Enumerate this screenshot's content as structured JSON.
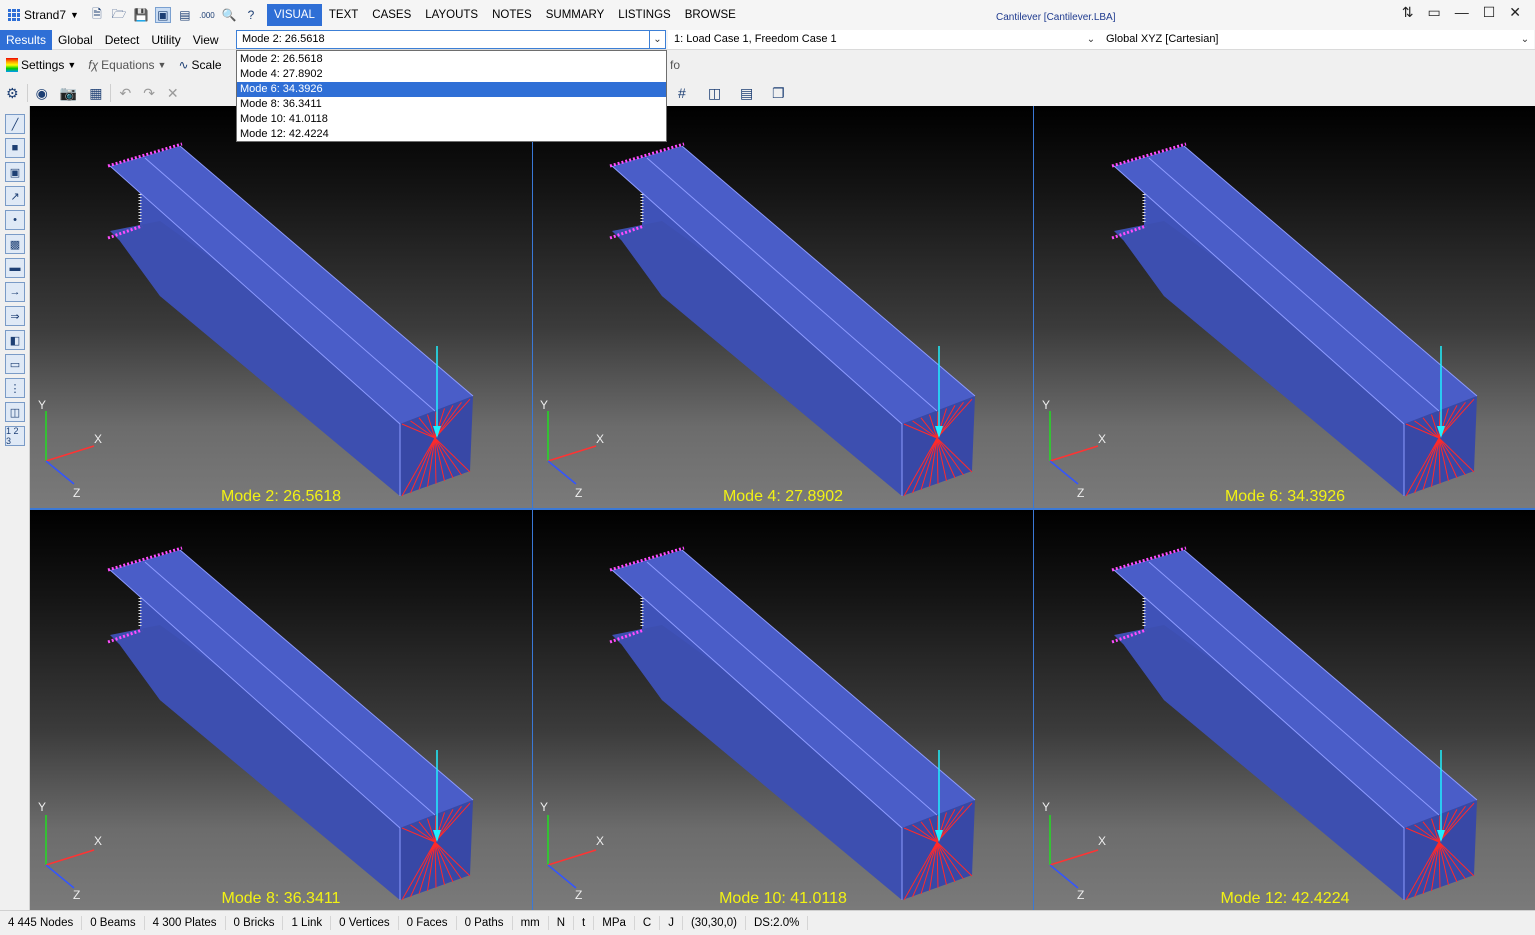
{
  "app": {
    "name": "Strand7",
    "window_title": "Cantilever [Cantilever.LBA]"
  },
  "ribbon_tabs": [
    "VISUAL",
    "TEXT",
    "CASES",
    "LAYOUTS",
    "NOTES",
    "SUMMARY",
    "LISTINGS",
    "BROWSE"
  ],
  "subtabs": [
    "Results",
    "Global",
    "Detect",
    "Utility",
    "View"
  ],
  "mode_select": {
    "value": "Mode 2: 26.5618",
    "options": [
      "Mode 2: 26.5618",
      "Mode 4: 27.8902",
      "Mode 6: 34.3926",
      "Mode 8: 36.3411",
      "Mode 10: 41.0118",
      "Mode 12: 42.4224"
    ],
    "highlighted": "Mode 6: 34.3926"
  },
  "case_select": {
    "value": "1: Load Case 1, Freedom Case 1"
  },
  "coord_select": {
    "value": "Global XYZ [Cartesian]"
  },
  "toolbar3": {
    "settings": "Settings",
    "equations": "Equations",
    "scale": "Scale",
    "info": "fo"
  },
  "viewports": [
    {
      "label": "Mode 2: 26.5618"
    },
    {
      "label": "Mode 4: 27.8902"
    },
    {
      "label": "Mode 6: 34.3926"
    },
    {
      "label": "Mode 8: 36.3411"
    },
    {
      "label": "Mode 10: 41.0118"
    },
    {
      "label": "Mode 12: 42.4224"
    }
  ],
  "axes": {
    "x": "X",
    "y": "Y",
    "z": "Z"
  },
  "status": [
    "4 445 Nodes",
    "0 Beams",
    "4 300 Plates",
    "0 Bricks",
    "1 Link",
    "0 Vertices",
    "0 Faces",
    "0 Paths",
    "mm",
    "N",
    "t",
    "MPa",
    "C",
    "J",
    "(30,30,0)",
    "DS:2.0%"
  ],
  "icons": {
    "numbered": "1 2 3"
  }
}
